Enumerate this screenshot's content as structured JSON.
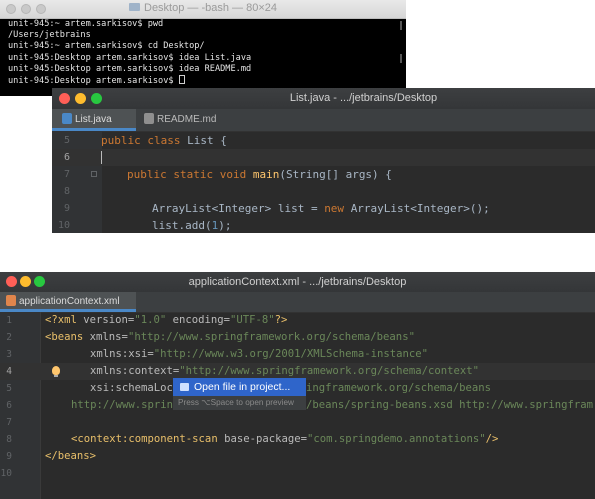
{
  "terminal": {
    "title": "Desktop — -bash — 80×24",
    "lines": [
      "unit-945:~ artem.sarkisov$ pwd",
      "/Users/jetbrains",
      "unit-945:~ artem.sarkisov$ cd Desktop/",
      "unit-945:Desktop artem.sarkisov$ idea List.java",
      "unit-945:Desktop artem.sarkisov$ idea README.md",
      "unit-945:Desktop artem.sarkisov$ "
    ]
  },
  "ide1": {
    "title": "List.java - .../jetbrains/Desktop",
    "tabs": [
      {
        "label": "List.java",
        "active": true
      },
      {
        "label": "README.md",
        "active": false
      }
    ],
    "line_numbers": [
      "5",
      "6",
      "7",
      "8",
      "9",
      "10"
    ],
    "code": {
      "line5": {
        "kw": "public class ",
        "rest": "List {"
      },
      "line7": {
        "kw": "public static void ",
        "fn": "main",
        "rest": "(String[] args) {"
      },
      "line9": {
        "a": "ArrayList<Integer> list = ",
        "kw": "new ",
        "b": "ArrayList<Integer>();"
      },
      "line10": {
        "a": "list.add(",
        "num": "1",
        "b": ");"
      }
    }
  },
  "ide2": {
    "title": "applicationContext.xml - .../jetbrains/Desktop",
    "tab": "applicationContext.xml",
    "line_numbers": [
      "1",
      "2",
      "3",
      "4",
      "5",
      "6",
      "7",
      "8",
      "9",
      "10"
    ],
    "code": {
      "l1": {
        "a": "<?xml ",
        "attr1": "version=",
        "val1": "\"1.0\" ",
        "attr2": "encoding=",
        "val2": "\"UTF-8\"",
        "b": "?>"
      },
      "l2": {
        "tag": "<beans ",
        "attr": "xmlns=",
        "val": "\"http://www.springframework.org/schema/beans\""
      },
      "l3": {
        "attr": "xmlns:xsi=",
        "val": "\"http://www.w3.org/2001/XMLSchema-instance\""
      },
      "l4": {
        "attr": "xmlns:context=",
        "val": "\"http://www.springframework.org/schema/context\""
      },
      "l5": {
        "attr": "xsi:schemaLoc",
        "val": "ingframework.org/schema/beans"
      },
      "l6": {
        "a": "http://www.sprin",
        "b": "/beans/spring-beans.xsd http://www.springfram"
      },
      "l8": {
        "tag": "<context:component-scan ",
        "attr": "base-package=",
        "val": "\"com.springdemo.annotations\"",
        "end": "/>"
      },
      "l9": {
        "tag": "</beans>"
      }
    },
    "popup": {
      "item": "Open file in project...",
      "hint": "Press ⌥Space to open preview"
    }
  },
  "colors": {
    "editor_bg": "#2b2b2b",
    "keyword": "#cc7832",
    "string": "#6a8759",
    "tag": "#e8bf6a",
    "popup_selection": "#2f65ca",
    "tab_underline": "#4a88c7"
  },
  "icons": {
    "java_file": "java-file-icon",
    "md_file": "markdown-file-icon",
    "xml_file": "xml-file-icon",
    "intention": "lightbulb-icon",
    "open_file": "open-file-icon"
  }
}
